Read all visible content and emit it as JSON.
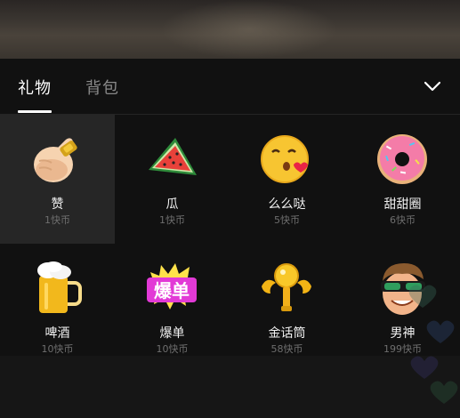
{
  "tabs": [
    {
      "label": "礼物",
      "active": true
    },
    {
      "label": "背包",
      "active": false
    }
  ],
  "gifts": [
    {
      "name": "赞",
      "price": "1快币",
      "icon": "thumbs-up-icon",
      "selected": true
    },
    {
      "name": "瓜",
      "price": "1快币",
      "icon": "watermelon-icon"
    },
    {
      "name": "么么哒",
      "price": "5快币",
      "icon": "kiss-emoji-icon"
    },
    {
      "name": "甜甜圈",
      "price": "6快币",
      "icon": "donut-icon"
    },
    {
      "name": "啤酒",
      "price": "10快币",
      "icon": "beer-icon"
    },
    {
      "name": "爆单",
      "price": "10快币",
      "icon": "bao-dan-badge-icon",
      "badge_text": "爆单"
    },
    {
      "name": "金话筒",
      "price": "58快币",
      "icon": "golden-microphone-icon"
    },
    {
      "name": "男神",
      "price": "199快币",
      "icon": "cool-guy-icon"
    }
  ],
  "colors": {
    "panel_bg": "#111111",
    "selected_bg": "#262626",
    "active_tab": "#ffffff",
    "inactive_tab": "#8a8a8a",
    "price_text": "#6e6e6e"
  }
}
